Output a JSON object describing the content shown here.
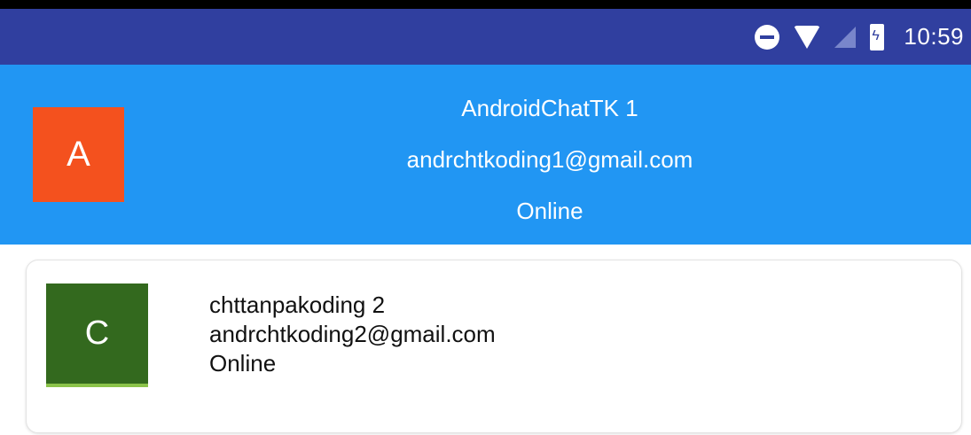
{
  "status_bar": {
    "time": "10:59",
    "icons": [
      "do-not-disturb-icon",
      "wifi-icon",
      "no-signal-icon",
      "battery-charging-icon"
    ],
    "color": "#303f9f"
  },
  "header": {
    "avatar_letter": "A",
    "avatar_color": "#f4511e",
    "name": "AndroidChatTK 1",
    "email": "andrchtkoding1@gmail.com",
    "status": "Online",
    "color": "#2196f3"
  },
  "users": [
    {
      "avatar_letter": "C",
      "avatar_color": "#33691e",
      "name": "chttanpakoding 2",
      "email": "andrchtkoding2@gmail.com",
      "status": "Online"
    }
  ]
}
